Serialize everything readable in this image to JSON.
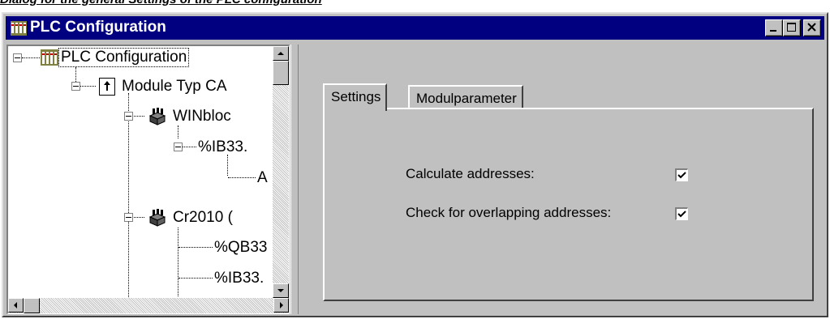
{
  "caption": "Dialog for the general Settings of the PLC configuration",
  "window": {
    "title": "PLC Configuration"
  },
  "tree": {
    "items": [
      {
        "label": "PLC Configuration",
        "icon": "plc-rack-icon"
      },
      {
        "label": "Module Typ CA",
        "icon": "module-arrow-icon"
      },
      {
        "label": "WINbloc",
        "icon": "io-module-icon"
      },
      {
        "label": "%IB33.",
        "icon": ""
      },
      {
        "label": "A",
        "icon": ""
      },
      {
        "label": "Cr2010 (",
        "icon": "io-module-icon"
      },
      {
        "label": "%QB33",
        "icon": ""
      },
      {
        "label": "%IB33.",
        "icon": ""
      }
    ]
  },
  "tabs": [
    {
      "label": "Settings",
      "active": true
    },
    {
      "label": "Modulparameter",
      "active": false
    }
  ],
  "settings": {
    "calculate_addresses": {
      "label": "Calculate addresses:",
      "checked": true
    },
    "check_overlapping": {
      "label": "Check for overlapping addresses:",
      "checked": true
    }
  },
  "colors": {
    "titlebar": "#000080",
    "face": "#c0c0c0"
  }
}
